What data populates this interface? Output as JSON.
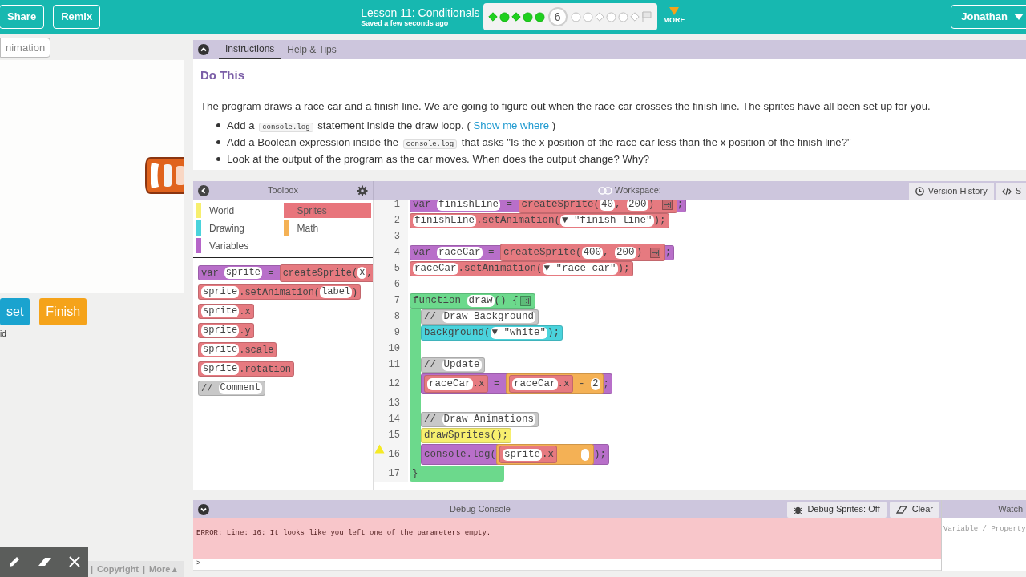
{
  "header": {
    "buttons": [
      "Share",
      "Remix"
    ],
    "lesson_title": "Lesson 11: Conditionals",
    "save_status": "Saved a few seconds ago",
    "progress": [
      {
        "kind": "diamond",
        "completed": true
      },
      {
        "kind": "circle",
        "completed": true
      },
      {
        "kind": "diamond",
        "completed": true
      },
      {
        "kind": "circle",
        "completed": true
      },
      {
        "kind": "circle",
        "completed": true
      },
      {
        "kind": "number",
        "completed": false,
        "label": "6"
      },
      {
        "kind": "circle",
        "completed": false
      },
      {
        "kind": "circle",
        "completed": false
      },
      {
        "kind": "diamond",
        "completed": false
      },
      {
        "kind": "circle",
        "completed": false
      },
      {
        "kind": "circle",
        "completed": false
      },
      {
        "kind": "diamond",
        "completed": false
      },
      {
        "kind": "flag",
        "completed": false
      }
    ],
    "more": "MORE",
    "user": "Jonathan"
  },
  "left_panel": {
    "animation_button": "nimation",
    "buttons": [
      {
        "label": "set",
        "color": "#1aa3cf"
      },
      {
        "label": "Finish",
        "color": "#f5a31a"
      }
    ],
    "note": "id",
    "footer": {
      "separator": "|",
      "links": [
        "Copyright",
        "More ▴"
      ]
    }
  },
  "instructions": {
    "tabs": [
      {
        "label": "Instructions",
        "selected": true
      },
      {
        "label": "Help & Tips",
        "selected": false
      }
    ],
    "heading": "Do This",
    "intro": "The program draws a race car and a finish line. We are going to figure out when the race car crosses the finish line. The sprites have all been set up for you.",
    "bullets": [
      [
        {
          "kind": "text",
          "text": "Add a "
        },
        {
          "kind": "code",
          "text": "console.log"
        },
        {
          "kind": "text",
          "text": " statement inside the draw loop. ( "
        },
        {
          "kind": "link",
          "text": "Show me where"
        },
        {
          "kind": "text",
          "text": " )"
        }
      ],
      [
        {
          "kind": "text",
          "text": "Add a Boolean expression inside the "
        },
        {
          "kind": "code",
          "text": "console.log"
        },
        {
          "kind": "text",
          "text": " that asks \"Is the x position of the race car less than the x position of the finish line?\""
        }
      ],
      [
        {
          "kind": "text",
          "text": "Look at the output of the program as the car moves. When does the output change? Why?"
        }
      ]
    ]
  },
  "toolbox": {
    "title": "Toolbox",
    "categories": [
      {
        "label": "World",
        "color": "#f7ef6e",
        "selected": false
      },
      {
        "label": "Sprites",
        "color": "#e8757c",
        "selected": true
      },
      {
        "label": "Drawing",
        "color": "#4ad3dc",
        "selected": false
      },
      {
        "label": "Math",
        "color": "#f4b155",
        "selected": false
      },
      {
        "label": "Variables",
        "color": "#b565c8",
        "selected": false
      }
    ],
    "blocks": [
      {
        "color": "#b86fc9",
        "parts": [
          {
            "kind": "text",
            "text": "var "
          },
          {
            "kind": "slot",
            "text": "sprite"
          },
          {
            "kind": "text",
            "text": " = "
          },
          {
            "kind": "block",
            "color": "#e67a80",
            "parts": [
              {
                "kind": "text",
                "text": "createSprite("
              },
              {
                "kind": "slot",
                "text": "x"
              },
              {
                "kind": "text",
                "text": ","
              }
            ]
          }
        ]
      },
      {
        "color": "#e67a80",
        "parts": [
          {
            "kind": "slot",
            "text": "sprite"
          },
          {
            "kind": "text",
            "text": ".setAnimation("
          },
          {
            "kind": "slot",
            "text": "label"
          },
          {
            "kind": "text",
            "text": ")"
          }
        ]
      },
      {
        "color": "#e67a80",
        "parts": [
          {
            "kind": "slot",
            "text": "sprite"
          },
          {
            "kind": "text",
            "text": ".x"
          }
        ]
      },
      {
        "color": "#e67a80",
        "parts": [
          {
            "kind": "slot",
            "text": "sprite"
          },
          {
            "kind": "text",
            "text": ".y"
          }
        ]
      },
      {
        "color": "#e67a80",
        "parts": [
          {
            "kind": "slot",
            "text": "sprite"
          },
          {
            "kind": "text",
            "text": ".scale"
          }
        ]
      },
      {
        "color": "#e67a80",
        "parts": [
          {
            "kind": "slot",
            "text": "sprite"
          },
          {
            "kind": "text",
            "text": ".rotation"
          }
        ]
      },
      {
        "color": "#c8c8c8",
        "parts": [
          {
            "kind": "text",
            "text": "// "
          },
          {
            "kind": "slot",
            "text": "Comment"
          }
        ]
      }
    ]
  },
  "workspace": {
    "title": "Workspace:",
    "buttons": [
      "Version History",
      "S"
    ],
    "lines": [
      {
        "number": "1",
        "warning": false,
        "color": "#b86fc9",
        "parts": [
          {
            "kind": "text",
            "text": "var "
          },
          {
            "kind": "slot",
            "text": "finishLine"
          },
          {
            "kind": "text",
            "text": " = "
          },
          {
            "kind": "block",
            "color": "#e67a80",
            "parts": [
              {
                "kind": "text",
                "text": "createSprite("
              },
              {
                "kind": "slot",
                "text": "40"
              },
              {
                "kind": "text",
                "text": ", "
              },
              {
                "kind": "slot",
                "text": "200"
              },
              {
                "kind": "text",
                "text": ") "
              },
              {
                "kind": "expander"
              }
            ]
          },
          {
            "kind": "text",
            "text": ";"
          }
        ]
      },
      {
        "number": "2",
        "warning": false,
        "color": "#e67a80",
        "parts": [
          {
            "kind": "slot",
            "text": "finishLine"
          },
          {
            "kind": "text",
            "text": ".setAnimation("
          },
          {
            "kind": "slot",
            "text": "▼ \"finish_line\""
          },
          {
            "kind": "text",
            "text": ");"
          }
        ]
      },
      {
        "number": "3",
        "warning": false
      },
      {
        "number": "4",
        "warning": false,
        "color": "#b86fc9",
        "parts": [
          {
            "kind": "text",
            "text": "var "
          },
          {
            "kind": "slot",
            "text": "raceCar"
          },
          {
            "kind": "text",
            "text": " = "
          },
          {
            "kind": "block",
            "color": "#e67a80",
            "parts": [
              {
                "kind": "text",
                "text": "createSprite("
              },
              {
                "kind": "slot",
                "text": "400"
              },
              {
                "kind": "text",
                "text": ", "
              },
              {
                "kind": "slot",
                "text": "200"
              },
              {
                "kind": "text",
                "text": ") "
              },
              {
                "kind": "expander"
              }
            ]
          },
          {
            "kind": "text",
            "text": ";"
          }
        ]
      },
      {
        "number": "5",
        "warning": false,
        "color": "#e67a80",
        "parts": [
          {
            "kind": "slot",
            "text": "raceCar"
          },
          {
            "kind": "text",
            "text": ".setAnimation("
          },
          {
            "kind": "slot",
            "text": "▼ \"race_car\""
          },
          {
            "kind": "text",
            "text": ");"
          }
        ]
      },
      {
        "number": "6",
        "warning": false
      },
      {
        "number": "7",
        "warning": false,
        "color": "#6cd98c",
        "parts": [
          {
            "kind": "text",
            "text": "function "
          },
          {
            "kind": "slot",
            "text": "draw"
          },
          {
            "kind": "text",
            "text": "() {"
          },
          {
            "kind": "expander"
          }
        ],
        "children": [
          {
            "number": "8",
            "warning": false,
            "color": "#c8c8c8",
            "parts": [
              {
                "kind": "text",
                "text": "// "
              },
              {
                "kind": "slot",
                "text": "Draw Background"
              }
            ]
          },
          {
            "number": "9",
            "warning": false,
            "color": "#4ad3dc",
            "parts": [
              {
                "kind": "text",
                "text": "background("
              },
              {
                "kind": "slot",
                "text": "▼ \"white\""
              },
              {
                "kind": "text",
                "text": ");"
              }
            ]
          },
          {
            "number": "10",
            "warning": false
          },
          {
            "number": "11",
            "warning": false,
            "color": "#c8c8c8",
            "parts": [
              {
                "kind": "text",
                "text": "// "
              },
              {
                "kind": "slot",
                "text": "Update"
              }
            ]
          },
          {
            "number": "12",
            "warning": false,
            "color": "#b86fc9",
            "parts": [
              {
                "kind": "block",
                "color": "#e67a80",
                "parts": [
                  {
                    "kind": "slot",
                    "text": "raceCar"
                  },
                  {
                    "kind": "text",
                    "text": ".x"
                  }
                ]
              },
              {
                "kind": "text",
                "text": " = "
              },
              {
                "kind": "block",
                "color": "#f4b155",
                "parts": [
                  {
                    "kind": "block",
                    "color": "#e67a80",
                    "parts": [
                      {
                        "kind": "slot",
                        "text": "raceCar"
                      },
                      {
                        "kind": "text",
                        "text": ".x"
                      }
                    ]
                  },
                  {
                    "kind": "text",
                    "text": " - "
                  },
                  {
                    "kind": "slot",
                    "text": "2"
                  }
                ]
              },
              {
                "kind": "text",
                "text": ";"
              }
            ]
          },
          {
            "number": "13",
            "warning": false
          },
          {
            "number": "14",
            "warning": false,
            "color": "#c8c8c8",
            "parts": [
              {
                "kind": "text",
                "text": "// "
              },
              {
                "kind": "slot",
                "text": "Draw Animations"
              }
            ]
          },
          {
            "number": "15",
            "warning": false,
            "color": "#f7ef6e",
            "parts": [
              {
                "kind": "text",
                "text": "drawSprites();"
              }
            ]
          },
          {
            "number": "16",
            "warning": true,
            "color": "#b86fc9",
            "parts": [
              {
                "kind": "text",
                "text": "console.log("
              },
              {
                "kind": "block",
                "color": "#f4b155",
                "parts": [
                  {
                    "kind": "block",
                    "color": "#e67a80",
                    "parts": [
                      {
                        "kind": "slot",
                        "text": "sprite"
                      },
                      {
                        "kind": "text",
                        "text": ".x"
                      }
                    ]
                  },
                  {
                    "kind": "empty_slot"
                  }
                ]
              },
              {
                "kind": "text",
                "text": ");"
              }
            ]
          }
        ],
        "closing": {
          "number": "17",
          "warning": false,
          "text": "}"
        }
      }
    ]
  },
  "console": {
    "title": "Debug Console",
    "buttons": [
      "Debug Sprites: Off",
      "Clear"
    ],
    "error": "ERROR: Line: 16: It looks like you left one of the parameters empty.",
    "prompt": ">"
  },
  "watch": {
    "title": "Watch",
    "placeholder": "Variable / Property"
  }
}
